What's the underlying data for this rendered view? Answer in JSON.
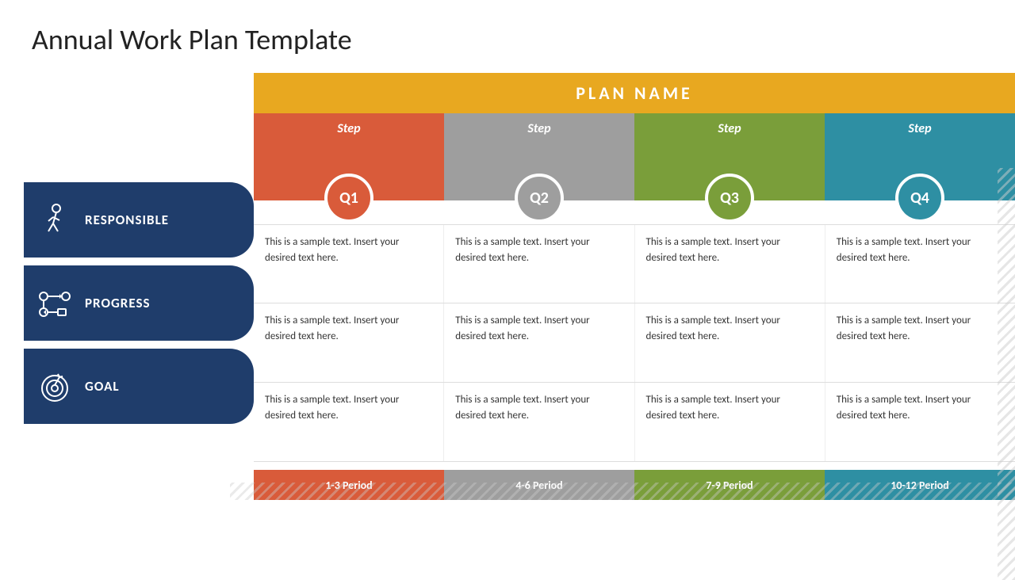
{
  "title": "Annual Work Plan Template",
  "plan_name": "PLAN NAME",
  "steps": [
    {
      "label": "Step",
      "quarter": "Q1",
      "color_class": "q1"
    },
    {
      "label": "Step",
      "quarter": "Q2",
      "color_class": "q2"
    },
    {
      "label": "Step",
      "quarter": "Q3",
      "color_class": "q3"
    },
    {
      "label": "Step",
      "quarter": "Q4",
      "color_class": "q4"
    }
  ],
  "rows": [
    {
      "label": "RESPONSIBLE",
      "cells": [
        "This is a sample text. Insert your desired text here.",
        "This is a sample text. Insert your desired text here.",
        "This is a sample text. Insert your desired text here.",
        "This is a sample text. Insert your desired text here."
      ]
    },
    {
      "label": "PROGRESS",
      "cells": [
        "This is a sample text. Insert your desired text here.",
        "This is a sample text. Insert your desired text here.",
        "This is a sample text. Insert your desired text here.",
        "This is a sample text. Insert your desired text here."
      ]
    },
    {
      "label": "GOAL",
      "cells": [
        "This is a sample text. Insert your desired text here.",
        "This is a sample text. Insert your desired text here.",
        "This is a sample text. Insert your desired text here.",
        "This is a sample text. Insert your desired text here."
      ]
    }
  ],
  "periods": [
    "1-3 Period",
    "4-6 Period",
    "7-9 Period",
    "10-12 Period"
  ]
}
